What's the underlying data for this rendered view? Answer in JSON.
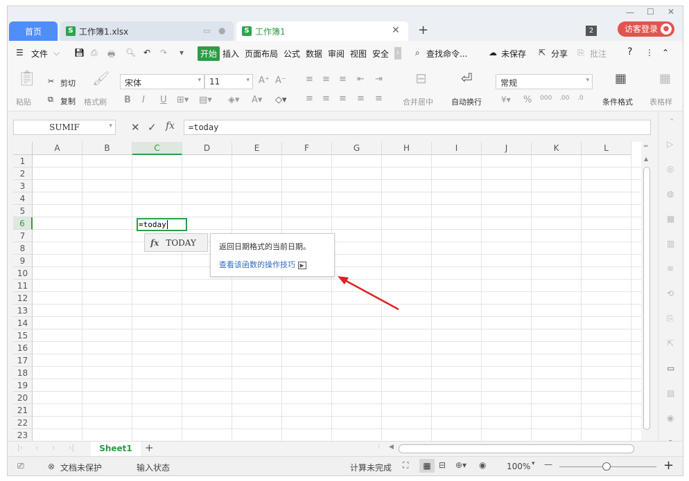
{
  "tabs": {
    "home": "首页",
    "file": "工作簿1.xlsx",
    "active": "工作簿1",
    "count": "2",
    "login": "访客登录"
  },
  "menu": {
    "file": "文件",
    "items": [
      "开始",
      "插入",
      "页面布局",
      "公式",
      "数据",
      "审阅",
      "视图",
      "安全"
    ],
    "search": "查找命令...",
    "unsaved": "未保存",
    "share": "分享",
    "comment": "批注"
  },
  "ribbon": {
    "paste": "粘贴",
    "cut": "剪切",
    "copy": "复制",
    "format_painter": "格式刷",
    "font": "宋体",
    "size": "11",
    "merge": "合并居中",
    "wrap": "自动换行",
    "number_format": "常规",
    "cond_format": "条件格式",
    "table_style": "表格样"
  },
  "formula_bar": {
    "name_box": "SUMIF",
    "content": "=today"
  },
  "grid": {
    "columns": [
      "A",
      "B",
      "C",
      "D",
      "E",
      "F",
      "G",
      "H",
      "I",
      "J",
      "K",
      "L"
    ],
    "rows": [
      "1",
      "2",
      "3",
      "4",
      "5",
      "6",
      "7",
      "8",
      "9",
      "10",
      "11",
      "12",
      "13",
      "14",
      "15",
      "16",
      "17",
      "18",
      "19",
      "20",
      "21",
      "22",
      "23"
    ],
    "active_col": "C",
    "active_row": "6",
    "cell_text": "=today"
  },
  "autocomplete": {
    "fx": "fx",
    "item": "TODAY"
  },
  "tooltip": {
    "desc": "返回日期格式的当前日期。",
    "link": "查看该函数的操作技巧"
  },
  "sheets": {
    "active": "Sheet1"
  },
  "status": {
    "protect": "文档未保护",
    "mode": "输入状态",
    "calc": "计算未完成",
    "zoom": "100%"
  },
  "colors": {
    "accent": "#2e9b45",
    "home_tab": "#4f8ef7",
    "login": "#e0554d",
    "arrow": "#e02020"
  }
}
